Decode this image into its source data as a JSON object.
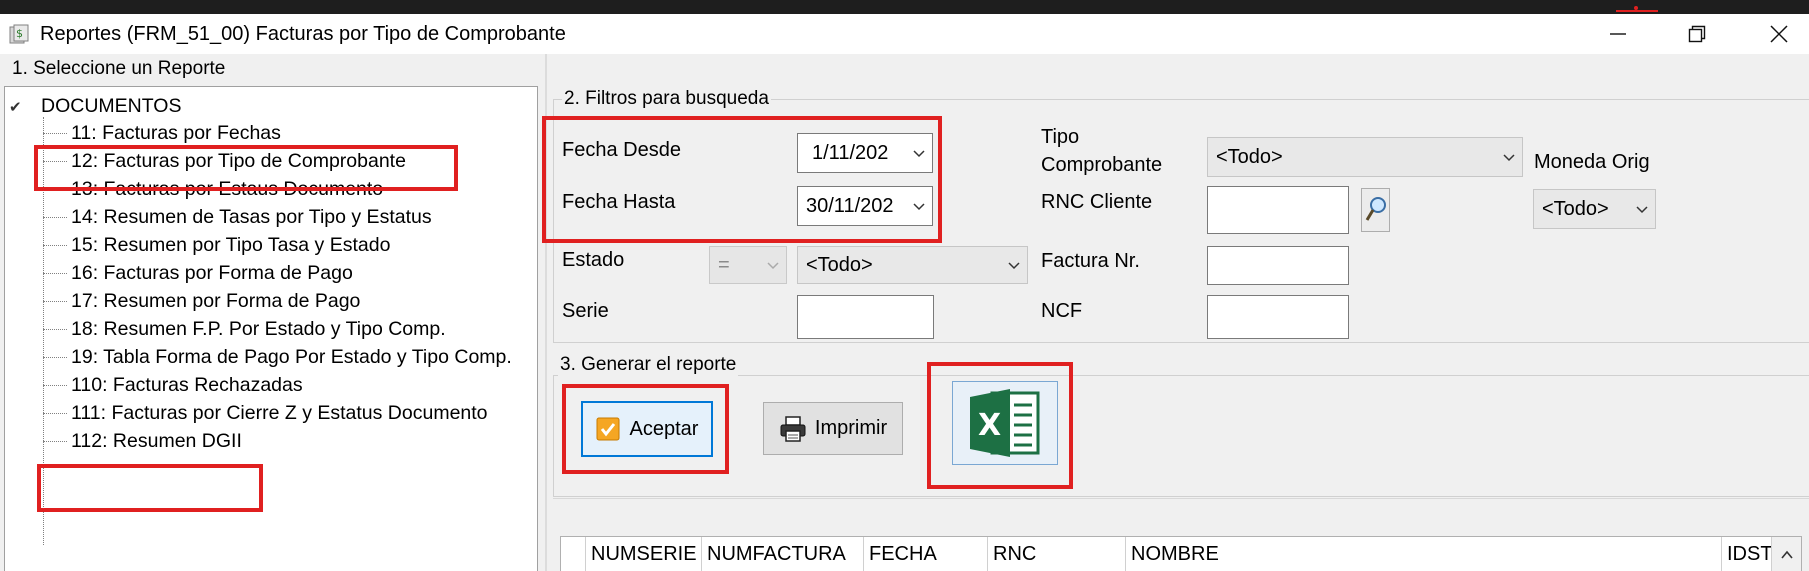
{
  "window": {
    "title": "Reportes (FRM_51_00) Facturas por Tipo de Comprobante",
    "minimize": "minimize",
    "restore": "restore",
    "close": "close"
  },
  "report_section": {
    "legend": "1. Seleccione un Reporte",
    "root": "DOCUMENTOS",
    "items": [
      "11: Facturas por Fechas",
      "12: Facturas por Tipo de Comprobante",
      "13: Facturas por Estaus Documento",
      "14: Resumen de Tasas por Tipo y Estatus",
      "15: Resumen por Tipo Tasa y Estado",
      "16: Facturas por Forma de Pago",
      "17: Resumen por Forma de Pago",
      "18: Resumen F.P. Por Estado y Tipo Comp.",
      "19: Tabla Forma de Pago Por Estado y Tipo Comp.",
      "110: Facturas Rechazadas",
      "111: Facturas por Cierre Z y Estatus Documento",
      "112: Resumen DGII"
    ]
  },
  "filters": {
    "legend": "2. Filtros para busqueda",
    "fecha_desde_label": "Fecha Desde",
    "fecha_desde_value": "1/11/202",
    "fecha_hasta_label": "Fecha Hasta",
    "fecha_hasta_value": "30/11/202",
    "estado_label": "Estado",
    "estado_operator": "=",
    "estado_value": "<Todo>",
    "serie_label": "Serie",
    "serie_value": "",
    "tipo_comprobante_label_1": "Tipo",
    "tipo_comprobante_label_2": "Comprobante",
    "tipo_comprobante_value": "<Todo>",
    "rnc_cliente_label": "RNC Cliente",
    "rnc_cliente_value": "",
    "factura_nr_label": "Factura Nr.",
    "factura_nr_value": "",
    "ncf_label": "NCF",
    "ncf_value": "",
    "moneda_label": "Moneda Orig",
    "moneda_value": "<Todo>"
  },
  "generate": {
    "legend": "3. Generar el reporte",
    "accept_label": "Aceptar",
    "print_label": "Imprimir",
    "excel_icon": "excel-icon"
  },
  "grid": {
    "columns": [
      "NUMSERIE",
      "NUMFACTURA",
      "FECHA",
      "RNC",
      "NOMBRE",
      "IDST"
    ]
  },
  "colors": {
    "highlight_red": "#e02020",
    "excel_green": "#1d7044",
    "primary_blue": "#0078d7"
  }
}
